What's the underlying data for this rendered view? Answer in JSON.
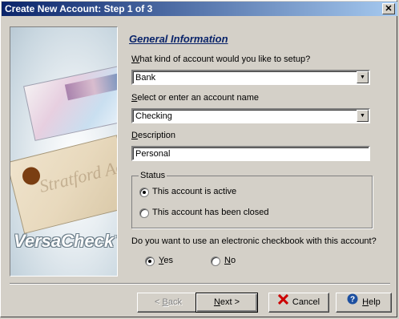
{
  "window": {
    "title": "Create New Account: Step 1 of 3",
    "close_glyph": "✕"
  },
  "side_panel": {
    "brand": "VersaCheck",
    "brand_mark": "™",
    "check_watermark": "Stratford Accounting"
  },
  "form": {
    "section_title": "General Information",
    "account_type": {
      "label_prefix": "W",
      "label_rest": "hat kind of account would you like to setup?",
      "value": "Bank"
    },
    "account_name": {
      "label_prefix": "S",
      "label_rest": "elect or enter an account name",
      "value": "Checking"
    },
    "description": {
      "label_prefix": "D",
      "label_rest": "escription",
      "value": "Personal"
    },
    "status": {
      "group_label": "Status",
      "options": [
        {
          "label": "This account is active",
          "selected": true
        },
        {
          "label": "This account has been closed",
          "selected": false
        }
      ]
    },
    "checkbook": {
      "question": "Do you want to use an electronic checkbook with this account?",
      "yes_prefix": "Y",
      "yes_rest": "es",
      "yes_selected": true,
      "no_prefix": "N",
      "no_rest": "o",
      "no_selected": false
    }
  },
  "buttons": {
    "back": {
      "prefix": "< ",
      "mnemonic": "B",
      "rest": "ack",
      "enabled": false
    },
    "next": {
      "mnemonic": "N",
      "rest": "ext >"
    },
    "cancel": {
      "label": "Cancel"
    },
    "help": {
      "mnemonic": "H",
      "rest": "elp"
    }
  },
  "colors": {
    "title_bar": "#0a246a",
    "section_title": "#0a246a",
    "cancel_icon": "#cc0000",
    "help_icon": "#1c4fa0"
  },
  "icons": {
    "cancel": "red-x-icon",
    "help": "question-circle-icon"
  }
}
